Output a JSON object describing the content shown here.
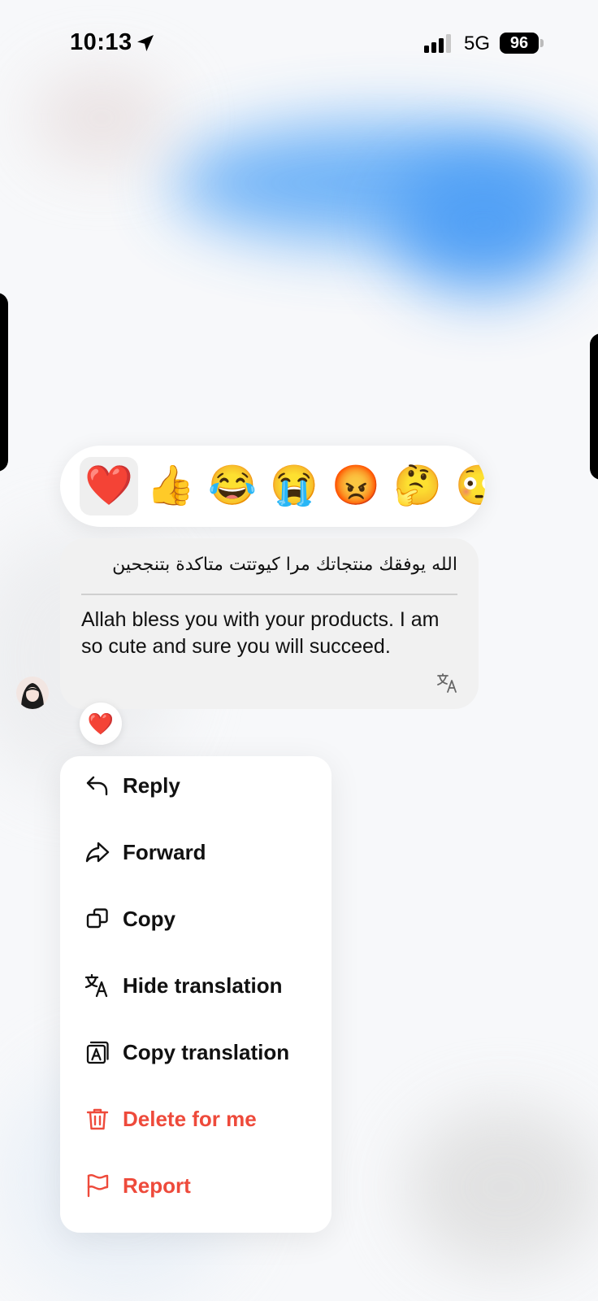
{
  "status_bar": {
    "time": "10:13",
    "network": "5G",
    "battery": "96"
  },
  "reactions": [
    "❤️",
    "👍",
    "😂",
    "😭",
    "😡",
    "🤔",
    "😳"
  ],
  "message": {
    "original_text": "الله يوفقك منتجاتك مرا كيوتتت متاكدة بتنجحين",
    "translated_text": "Allah bless you with your products. I am so cute and sure you will succeed.",
    "reaction": "❤️"
  },
  "menu": {
    "reply": "Reply",
    "forward": "Forward",
    "copy": "Copy",
    "hide_translation": "Hide translation",
    "copy_translation": "Copy translation",
    "delete_for_me": "Delete for me",
    "report": "Report"
  },
  "colors": {
    "danger": "#ee4a3b",
    "accent_blur": "#4a9cf5"
  }
}
